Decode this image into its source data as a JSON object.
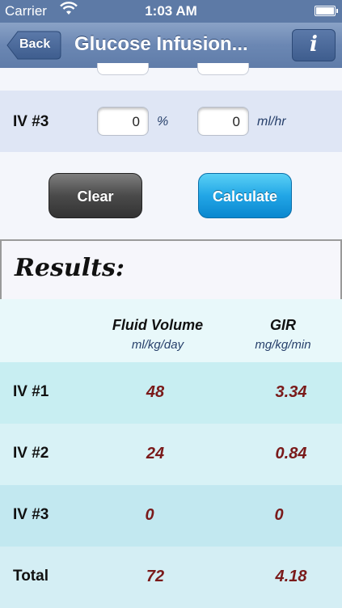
{
  "status": {
    "carrier": "Carrier",
    "time": "1:03 AM",
    "battery_level": 1.0
  },
  "nav": {
    "back_label": "Back",
    "title": "Glucose Infusion...",
    "info_label": "i"
  },
  "iv3_input": {
    "label": "IV #3",
    "percent_value": "0",
    "percent_unit": "%",
    "rate_value": "0",
    "rate_unit": "ml/hr"
  },
  "buttons": {
    "clear_label": "Clear",
    "calculate_label": "Calculate"
  },
  "results": {
    "heading": "Results:",
    "columns": [
      {
        "title": "Fluid Volume",
        "unit": "ml/kg/day"
      },
      {
        "title": "GIR",
        "unit": "mg/kg/min"
      }
    ],
    "rows": [
      {
        "label": "IV #1",
        "fluid": "48",
        "gir": "3.34"
      },
      {
        "label": "IV #2",
        "fluid": "24",
        "gir": "0.84"
      },
      {
        "label": "IV #3",
        "fluid": "0",
        "gir": "0"
      },
      {
        "label": "Total",
        "fluid": "72",
        "gir": "4.18"
      }
    ]
  },
  "colors": {
    "navbar": "#6b87b3",
    "value_text": "#7a1a1a",
    "row_colors": [
      "#c8eef2",
      "#d8f2f6",
      "#c2e8f0",
      "#d4eef4"
    ]
  }
}
